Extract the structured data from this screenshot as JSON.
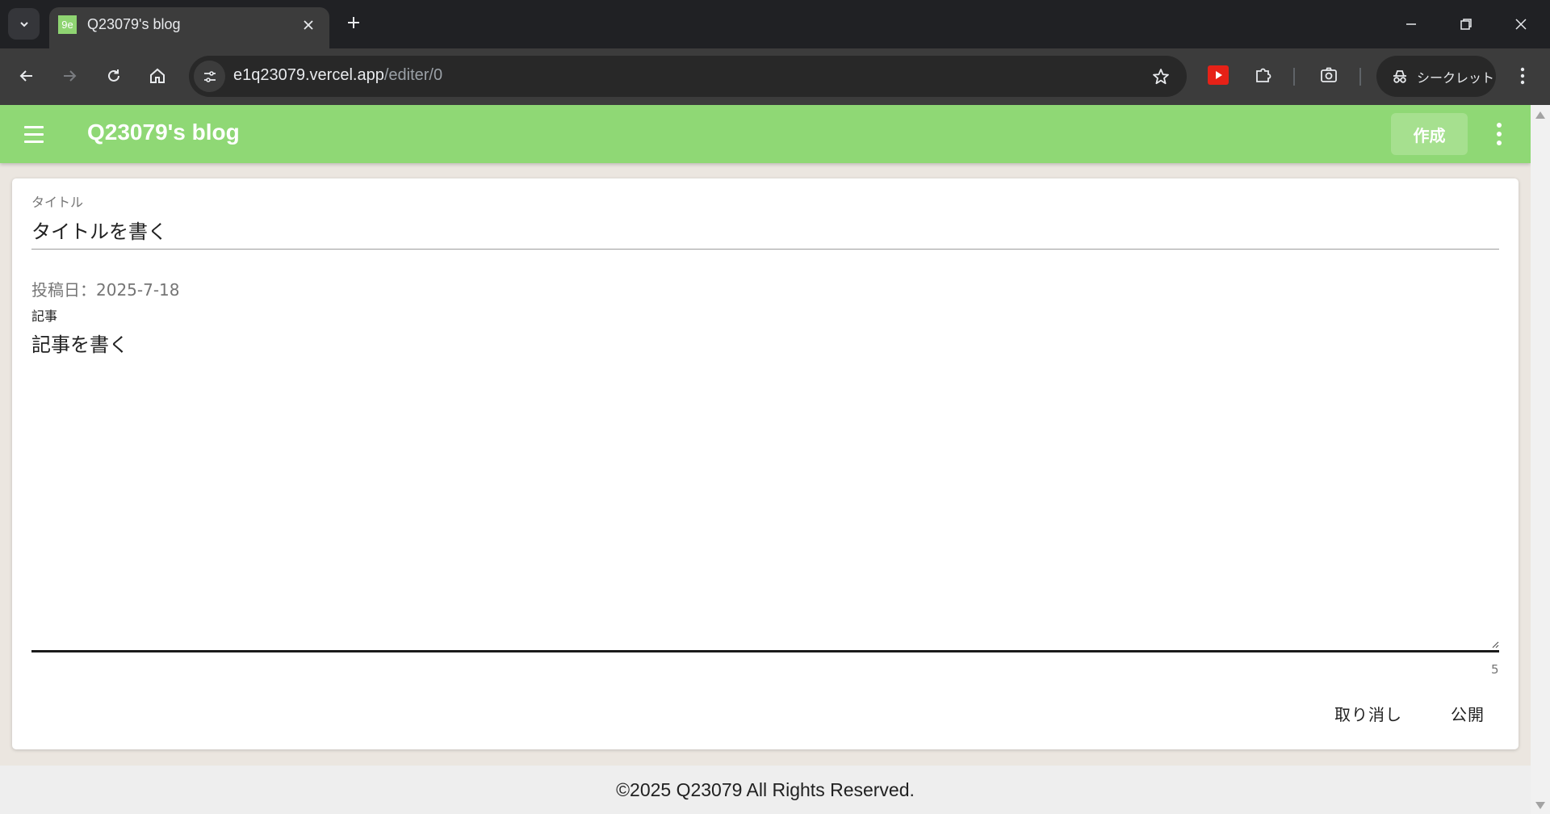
{
  "browser": {
    "tab": {
      "favicon_text": "9e",
      "title": "Q23079's blog"
    },
    "address": {
      "host": "e1q23079.vercel.app",
      "path": "/editer/0"
    },
    "incognito_label": "シークレット",
    "icons": {
      "tab_search": "chevron-down-icon",
      "tab_close": "close-icon",
      "new_tab": "plus-icon",
      "minimize": "minimize-icon",
      "restore": "restore-icon",
      "close_window": "close-icon",
      "back": "back-arrow-icon",
      "forward": "forward-arrow-icon",
      "reload": "reload-icon",
      "home": "home-icon",
      "site_info": "tune-icon",
      "bookmark": "star-icon",
      "youtube_ext": "youtube-icon",
      "extensions": "puzzle-icon",
      "screenshot": "camera-icon",
      "incognito": "incognito-icon",
      "menu": "kebab-menu-icon"
    }
  },
  "app": {
    "title": "Q23079's blog",
    "create_button": "作成",
    "accent_color": "#8fd875"
  },
  "editor": {
    "title_label": "タイトル",
    "title_value": "タイトルを書く",
    "post_date": "投稿日：2025-7-18",
    "body_label": "記事",
    "body_value": "記事を書く",
    "char_count": "5",
    "cancel_button": "取り消し",
    "publish_button": "公開"
  },
  "footer": {
    "text": "©2025 Q23079 All Rights Reserved."
  }
}
